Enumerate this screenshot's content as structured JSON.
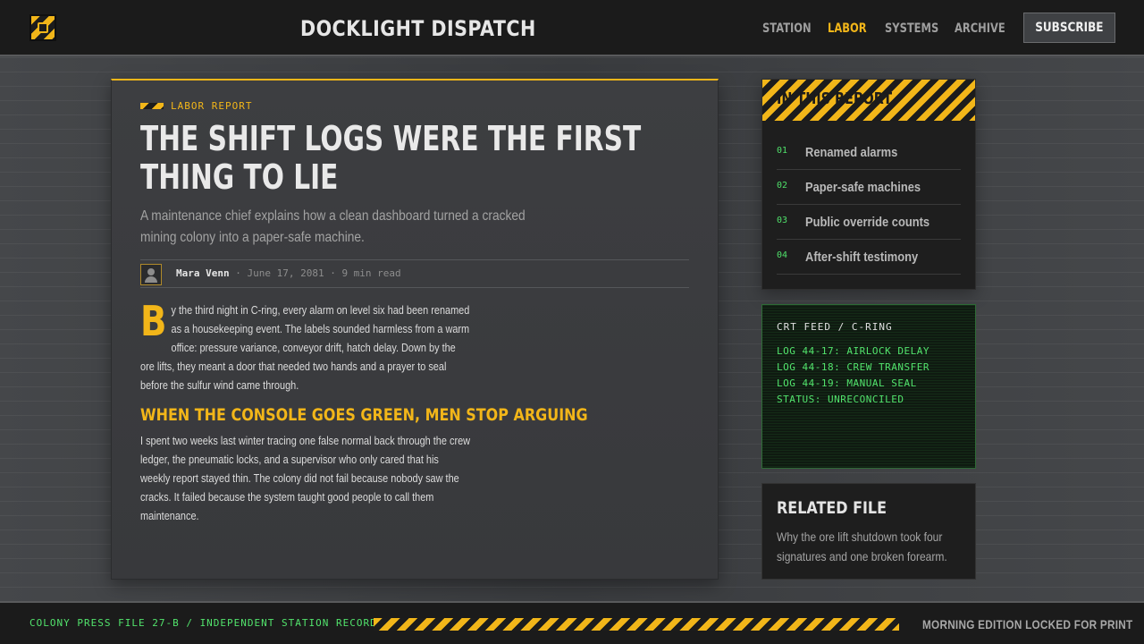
{
  "header": {
    "brand": "DOCKLIGHT DISPATCH",
    "nav": [
      {
        "label": "STATION",
        "active": false
      },
      {
        "label": "LABOR",
        "active": true
      },
      {
        "label": "SYSTEMS",
        "active": false
      },
      {
        "label": "ARCHIVE",
        "active": false
      }
    ],
    "subscribe_label": "SUBSCRIBE"
  },
  "article": {
    "kicker": "LABOR REPORT",
    "headline": "THE SHIFT LOGS WERE THE FIRST THING TO LIE",
    "dek": "A maintenance chief explains how a clean dashboard turned a cracked mining colony into a paper-safe machine.",
    "author": "Mara Venn",
    "meta": " · June 17, 2081 · 9 min read",
    "dropcap": "B",
    "para1": "y the third night in C-ring, every alarm on level six had been renamed as a housekeeping event. The labels sounded harmless from a warm office: pressure variance, conveyor drift, hatch delay. Down by the ore lifts, they meant a door that needed two hands and a prayer to seal before the sulfur wind came through.",
    "subhead": "WHEN THE CONSOLE GOES GREEN, MEN STOP ARGUING",
    "para2": "I spent two weeks last winter tracing one false normal back through the crew ledger, the pneumatic locks, and a supervisor who only cared that his weekly report stayed thin. The colony did not fail because nobody saw the cracks. It failed because the system taught good people to call them maintenance."
  },
  "toc": {
    "title": "IN THIS REPORT",
    "items": [
      {
        "num": "01",
        "label": "Renamed alarms"
      },
      {
        "num": "02",
        "label": "Paper-safe machines"
      },
      {
        "num": "03",
        "label": "Public override counts"
      },
      {
        "num": "04",
        "label": "After-shift testimony"
      }
    ]
  },
  "crt": {
    "title": "CRT FEED / C-RING",
    "lines": [
      "LOG 44-17: AIRLOCK DELAY",
      "LOG 44-18: CREW TRANSFER",
      "LOG 44-19: MANUAL SEAL",
      "STATUS: UNRECONCILED"
    ]
  },
  "related": {
    "title": "RELATED FILE",
    "text": "Why the ore lift shutdown took four signatures and one broken forearm."
  },
  "footer": {
    "left": "COLONY PRESS FILE 27-B / INDEPENDENT STATION RECORD",
    "right": "MORNING EDITION LOCKED FOR PRINT"
  },
  "colors": {
    "accent": "#f2b619",
    "terminal_green": "#52e36c",
    "background": "#3d3f42"
  }
}
